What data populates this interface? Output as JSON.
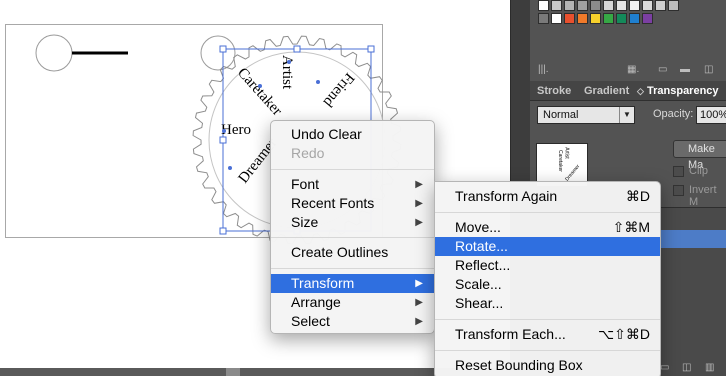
{
  "artwork": {
    "text_items": [
      "Artist",
      "Friend",
      "Caretaker",
      "Hero",
      "Dreamer"
    ]
  },
  "panel": {
    "tabs": [
      {
        "label": "Stroke"
      },
      {
        "label": "Gradient"
      },
      {
        "label": "Transparency",
        "active": true
      }
    ],
    "blend_mode": "Normal",
    "opacity_label": "Opacity:",
    "opacity_value": "100%",
    "make_mask_label": "Make Ma",
    "clip_label": "Clip",
    "invert_label": "Invert M",
    "swatch_colors": [
      "#e8502e",
      "#f07a2a",
      "#f6d02b",
      "#36a845",
      "#148a5a",
      "#1f7fcf",
      "#7b3fa2"
    ]
  },
  "context_menu": {
    "items": [
      {
        "label": "Undo Clear",
        "enabled": true
      },
      {
        "label": "Redo",
        "enabled": false
      },
      {
        "label": "Font",
        "submenu": true
      },
      {
        "label": "Recent Fonts",
        "submenu": true
      },
      {
        "label": "Size",
        "submenu": true
      },
      {
        "label": "Create Outlines"
      },
      {
        "label": "Transform",
        "submenu": true,
        "selected": true
      },
      {
        "label": "Arrange",
        "submenu": true
      },
      {
        "label": "Select",
        "submenu": true
      }
    ]
  },
  "transform_menu": {
    "items": [
      {
        "label": "Transform Again",
        "shortcut": "⌘D"
      },
      {
        "label": "Move...",
        "shortcut": "⇧⌘M"
      },
      {
        "label": "Rotate...",
        "selected": true
      },
      {
        "label": "Reflect..."
      },
      {
        "label": "Scale..."
      },
      {
        "label": "Shear..."
      },
      {
        "label": "Transform Each...",
        "shortcut": "⌥⇧⌘D"
      },
      {
        "label": "Reset Bounding Box"
      }
    ]
  },
  "colors": {
    "selection_blue": "#4a6fd6",
    "menu_highlight": "#2f6fe0"
  }
}
